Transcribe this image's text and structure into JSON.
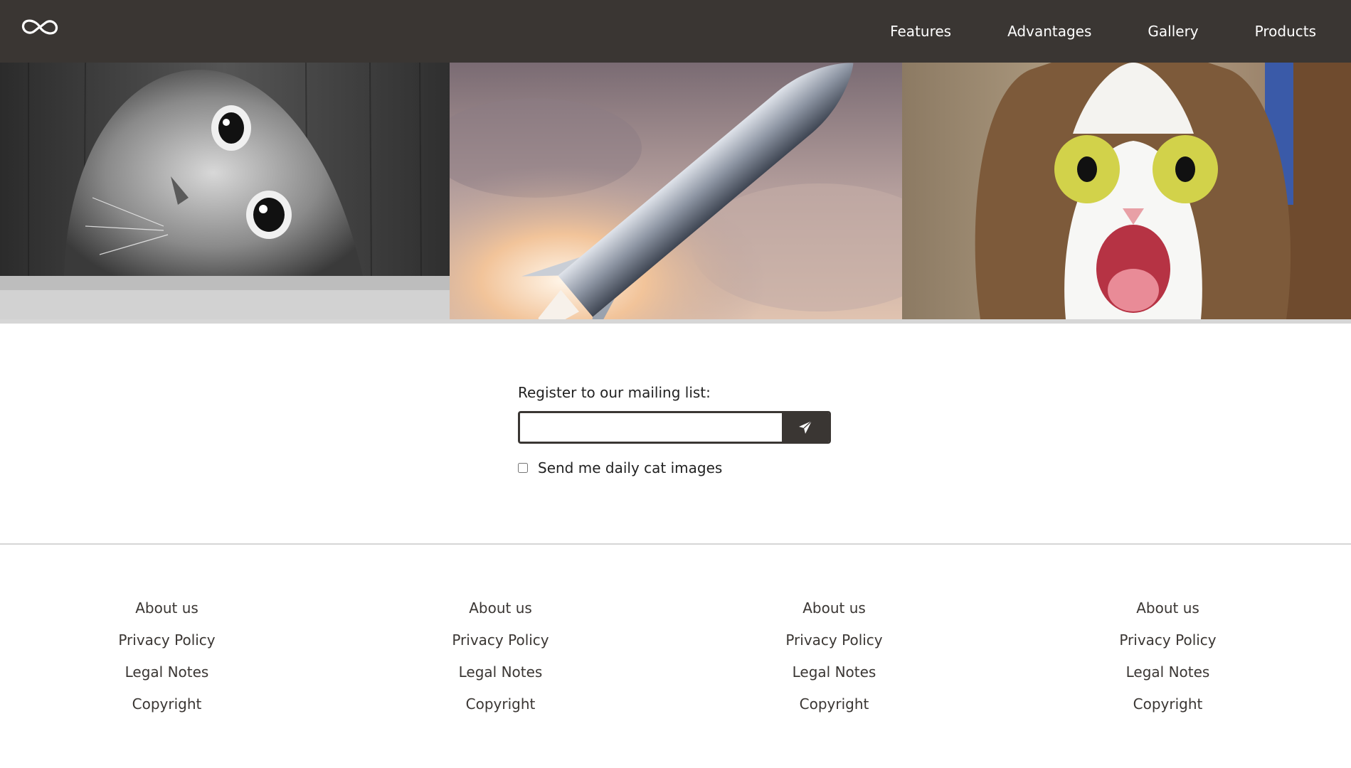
{
  "header": {
    "logo_icon": "infinity-icon",
    "nav": [
      {
        "label": "Features"
      },
      {
        "label": "Advantages"
      },
      {
        "label": "Gallery"
      },
      {
        "label": "Products"
      }
    ]
  },
  "hero": {
    "images": [
      {
        "subject": "black-and-white cat peeking through hole"
      },
      {
        "subject": "rocket launching through clouds"
      },
      {
        "subject": "surprised tabby cat"
      }
    ]
  },
  "mailing": {
    "label": "Register to our mailing list:",
    "email_value": "",
    "submit_icon": "paper-plane-icon",
    "checkbox_label": "Send me daily cat images",
    "checkbox_checked": false
  },
  "footer": {
    "columns": [
      {
        "links": [
          "About us",
          "Privacy Policy",
          "Legal Notes",
          "Copyright"
        ]
      },
      {
        "links": [
          "About us",
          "Privacy Policy",
          "Legal Notes",
          "Copyright"
        ]
      },
      {
        "links": [
          "About us",
          "Privacy Policy",
          "Legal Notes",
          "Copyright"
        ]
      },
      {
        "links": [
          "About us",
          "Privacy Policy",
          "Legal Notes",
          "Copyright"
        ]
      }
    ]
  },
  "colors": {
    "header_bg": "#3a3633",
    "nav_text": "#ffffff",
    "divider": "#d6d6d6",
    "button_bg": "#3a3633"
  }
}
